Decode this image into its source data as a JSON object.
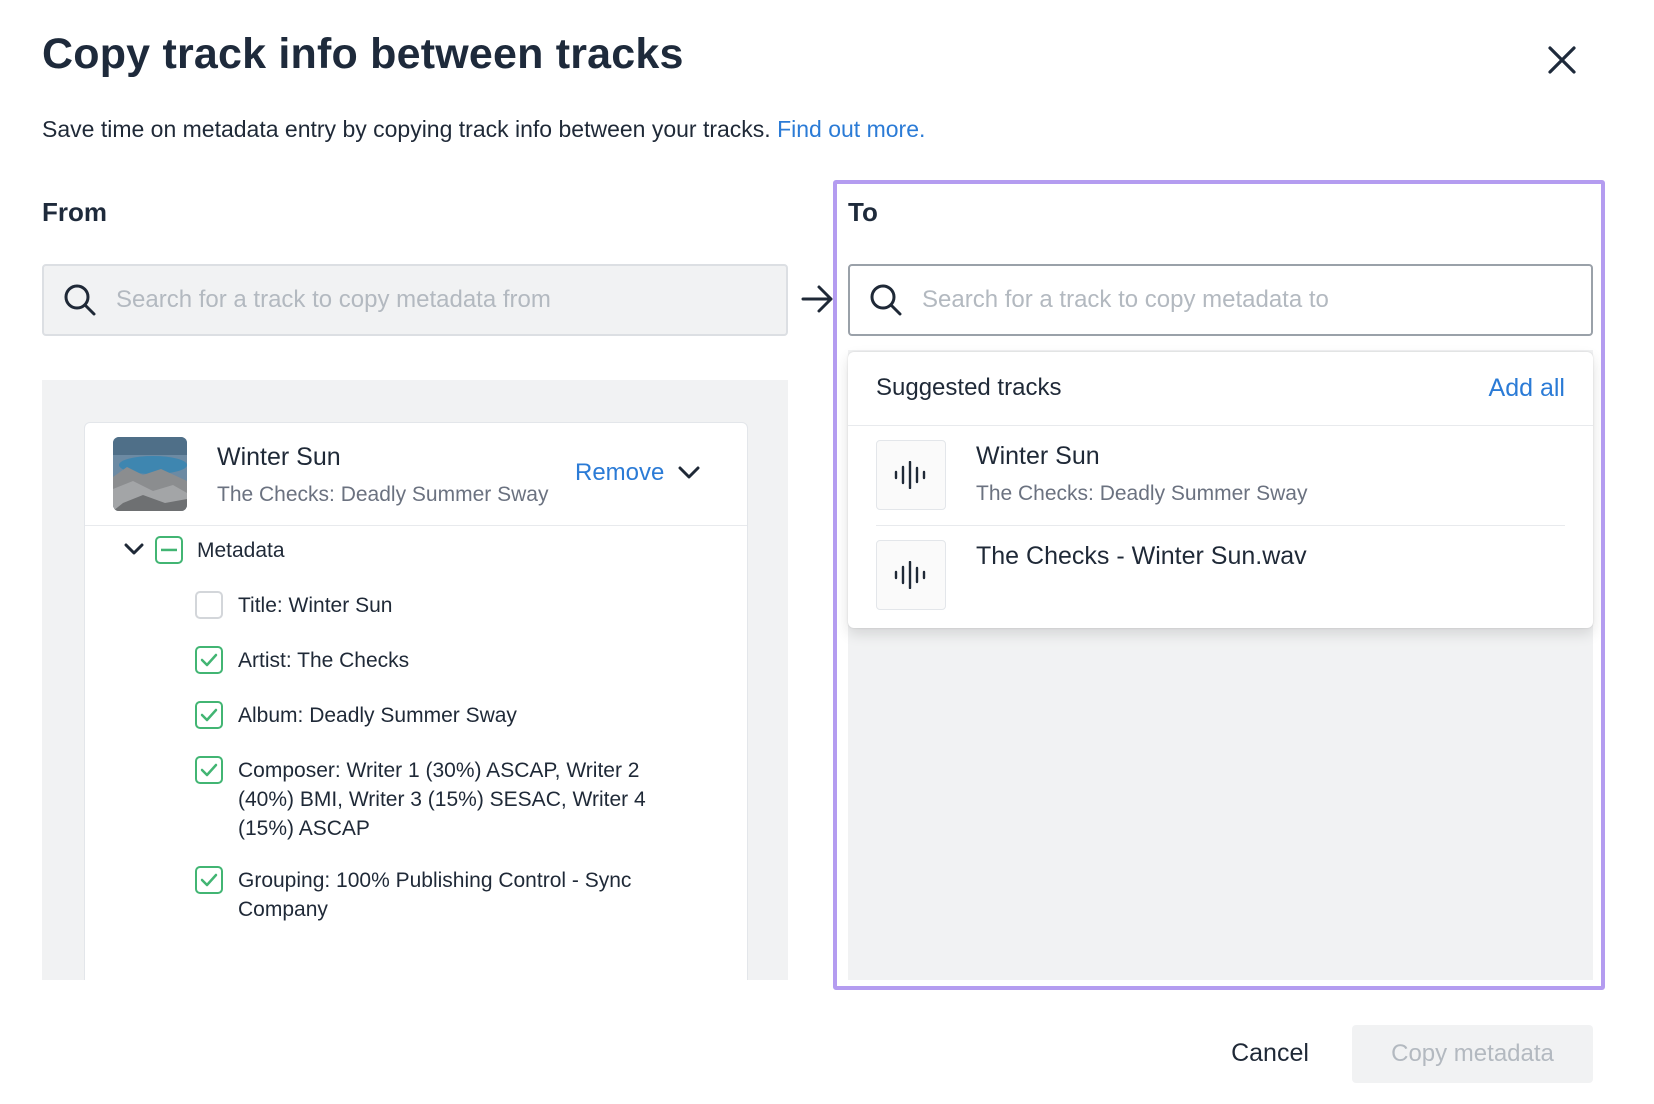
{
  "dialog": {
    "title": "Copy track info between tracks",
    "subtitle": "Save time on metadata entry by copying track info between your tracks.",
    "find_out_more": "Find out more."
  },
  "from": {
    "label": "From",
    "search_placeholder": "Search for a track to copy metadata from",
    "track": {
      "title": "Winter Sun",
      "subtitle": "The Checks: Deadly Summer Sway",
      "remove_label": "Remove"
    },
    "metadata": {
      "group_label": "Metadata",
      "items": [
        {
          "label": "Title: Winter Sun",
          "checked": false
        },
        {
          "label": "Artist: The Checks",
          "checked": true
        },
        {
          "label": "Album: Deadly Summer Sway",
          "checked": true
        },
        {
          "label": "Composer: Writer 1 (30%) ASCAP, Writer 2 (40%) BMI, Writer 3 (15%) SESAC, Writer 4 (15%) ASCAP",
          "checked": true
        },
        {
          "label": "Grouping: 100% Publishing Control - Sync Company",
          "checked": true
        }
      ]
    }
  },
  "to": {
    "label": "To",
    "search_placeholder": "Search for a track to copy metadata to",
    "suggested": {
      "title": "Suggested tracks",
      "add_all_label": "Add all",
      "items": [
        {
          "title": "Winter Sun",
          "subtitle": "The Checks: Deadly Summer Sway"
        },
        {
          "title": "The Checks - Winter Sun.wav",
          "subtitle": ""
        }
      ]
    }
  },
  "footer": {
    "cancel_label": "Cancel",
    "copy_label": "Copy metadata"
  },
  "colors": {
    "link": "#2b7bd6",
    "check_green": "#42b573",
    "highlight_border": "#b49cf0"
  }
}
